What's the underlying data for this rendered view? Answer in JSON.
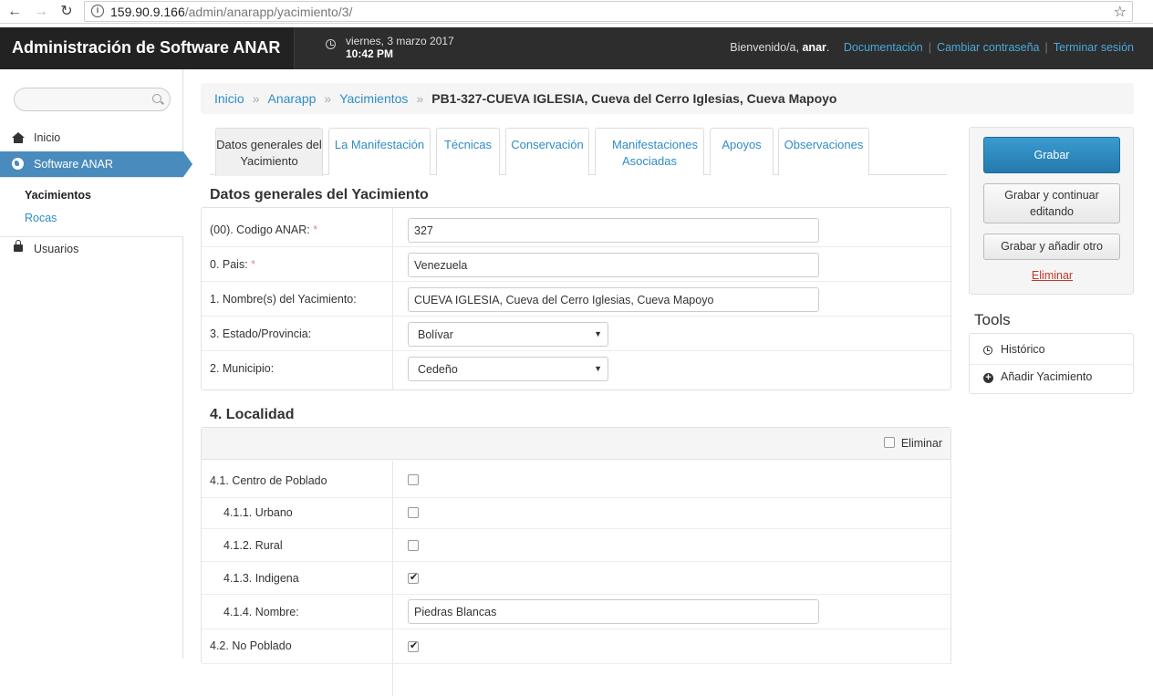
{
  "browser": {
    "url_host": "159.90.9.166",
    "url_path": "/admin/anarapp/yacimiento/3/"
  },
  "header": {
    "brand": "Administración de Software ANAR",
    "date": "viernes, 3 marzo 2017",
    "time": "10:42 PM",
    "welcome": "Bienvenido/a,",
    "username": "anar",
    "links": [
      "Documentación",
      "Cambiar contraseña",
      "Terminar sesión"
    ]
  },
  "sidebar": {
    "search_placeholder": "",
    "items": [
      {
        "label": "Inicio",
        "icon": "home-icon"
      },
      {
        "label": "Software ANAR",
        "icon": "globe-icon"
      },
      {
        "label": "Usuarios",
        "icon": "lock-icon"
      }
    ],
    "sub_items": [
      "Yacimientos",
      "Rocas"
    ]
  },
  "breadcrumb": {
    "items": [
      "Inicio",
      "Anarapp",
      "Yacimientos"
    ],
    "current": "PB1-327-CUEVA IGLESIA, Cueva del Cerro Iglesias, Cueva Mapoyo"
  },
  "tabs": [
    {
      "label": "Datos generales del Yacimiento"
    },
    {
      "label": "La Manifestación"
    },
    {
      "label": "Técnicas"
    },
    {
      "label": "Conservación"
    },
    {
      "label": "Manifestaciones Asociadas"
    },
    {
      "label": "Apoyos"
    },
    {
      "label": "Observaciones"
    }
  ],
  "section1": {
    "title": "Datos generales del Yacimiento",
    "fields": [
      {
        "label": "(00). Codigo ANAR:",
        "required": "*",
        "value": "327"
      },
      {
        "label": "0. Pais:",
        "required": "*",
        "value": "Venezuela"
      },
      {
        "label": "1. Nombre(s) del Yacimiento:",
        "value": "CUEVA IGLESIA, Cueva del Cerro Iglesias, Cueva Mapoyo"
      },
      {
        "label": "3. Estado/Provincia:",
        "value": "Bolívar"
      },
      {
        "label": "2. Municipio:",
        "value": "Cedeño"
      }
    ]
  },
  "section2": {
    "title": "4. Localidad",
    "delete_label": "Eliminar",
    "rows": [
      {
        "label": "4.1. Centro de Poblado",
        "checked": false
      },
      {
        "label": "4.1.1. Urbano",
        "checked": false
      },
      {
        "label": "4.1.2. Rural",
        "checked": false
      },
      {
        "label": "4.1.3. Indigena",
        "checked": true
      },
      {
        "label": "4.1.4. Nombre:",
        "value": "Piedras Blancas"
      },
      {
        "label": "4.2. No Poblado",
        "checked": true
      }
    ]
  },
  "actions": {
    "save": "Grabar",
    "save_continue": "Grabar y continuar editando",
    "save_add": "Grabar y añadir otro",
    "delete": "Eliminar"
  },
  "tools": {
    "title": "Tools",
    "items": [
      "Histórico",
      "Añadir Yacimiento"
    ]
  }
}
